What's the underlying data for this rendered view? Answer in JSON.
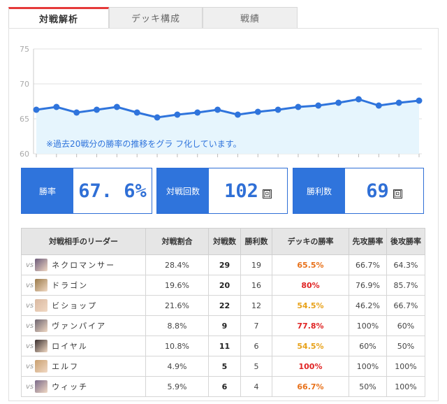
{
  "tabs": [
    {
      "label": "対戦解析",
      "active": true
    },
    {
      "label": "デッキ構成",
      "active": false
    },
    {
      "label": "戦績",
      "active": false
    }
  ],
  "chart_data": {
    "type": "line",
    "y_ticks": [
      "75",
      "70",
      "65",
      "60"
    ],
    "ylim": [
      60,
      75
    ],
    "x": [
      1,
      2,
      3,
      4,
      5,
      6,
      7,
      8,
      9,
      10,
      11,
      12,
      13,
      14,
      15,
      16,
      17,
      18,
      19,
      20
    ],
    "values": [
      66.3,
      66.7,
      65.9,
      66.3,
      66.7,
      65.9,
      65.2,
      65.6,
      65.9,
      66.3,
      65.6,
      66.0,
      66.3,
      66.7,
      66.9,
      67.3,
      67.8,
      66.9,
      67.3,
      67.6
    ],
    "annotation": "※過去20戦分の勝率の推移をグラ フ化しています。",
    "grid": true,
    "line_color": "#2f74dc",
    "fill_color": "#e6f5fd"
  },
  "stats": {
    "win_rate": {
      "label": "勝率",
      "value": "67. 6%"
    },
    "matches": {
      "label": "対戦回数",
      "value": "102",
      "unit": "回"
    },
    "wins": {
      "label": "勝利数",
      "value": "69",
      "unit": "回"
    }
  },
  "table": {
    "headers": [
      "対戦相手のリーダー",
      "対戦割合",
      "対戦数",
      "勝利数",
      "デッキの勝率",
      "先攻勝率",
      "後攻勝率"
    ],
    "vs_label": "vs",
    "rows": [
      {
        "leader": "ネクロマンサー",
        "ratio": "28.4%",
        "matches": "29",
        "wins": "19",
        "winrate": "65.5%",
        "first": "66.7%",
        "second": "64.3%",
        "color": "#e8711a",
        "avatar": "#6b5a7a"
      },
      {
        "leader": "ドラゴン",
        "ratio": "19.6%",
        "matches": "20",
        "wins": "16",
        "winrate": "80%",
        "first": "76.9%",
        "second": "85.7%",
        "color": "#e02424",
        "avatar": "#9a7a4a"
      },
      {
        "leader": "ビショップ",
        "ratio": "21.6%",
        "matches": "22",
        "wins": "12",
        "winrate": "54.5%",
        "first": "46.2%",
        "second": "66.7%",
        "color": "#e8a21a",
        "avatar": "#d9b8a0"
      },
      {
        "leader": "ヴァンパイア",
        "ratio": "8.8%",
        "matches": "9",
        "wins": "7",
        "winrate": "77.8%",
        "first": "100%",
        "second": "60%",
        "color": "#e02424",
        "avatar": "#6d6470"
      },
      {
        "leader": "ロイヤル",
        "ratio": "10.8%",
        "matches": "11",
        "wins": "6",
        "winrate": "54.5%",
        "first": "60%",
        "second": "50%",
        "color": "#e8a21a",
        "avatar": "#3a3030"
      },
      {
        "leader": "エルフ",
        "ratio": "4.9%",
        "matches": "5",
        "wins": "5",
        "winrate": "100%",
        "first": "100%",
        "second": "100%",
        "color": "#e02424",
        "avatar": "#c9a070"
      },
      {
        "leader": "ウィッチ",
        "ratio": "5.9%",
        "matches": "6",
        "wins": "4",
        "winrate": "66.7%",
        "first": "50%",
        "second": "100%",
        "color": "#e8711a",
        "avatar": "#7a6a8a"
      }
    ]
  }
}
